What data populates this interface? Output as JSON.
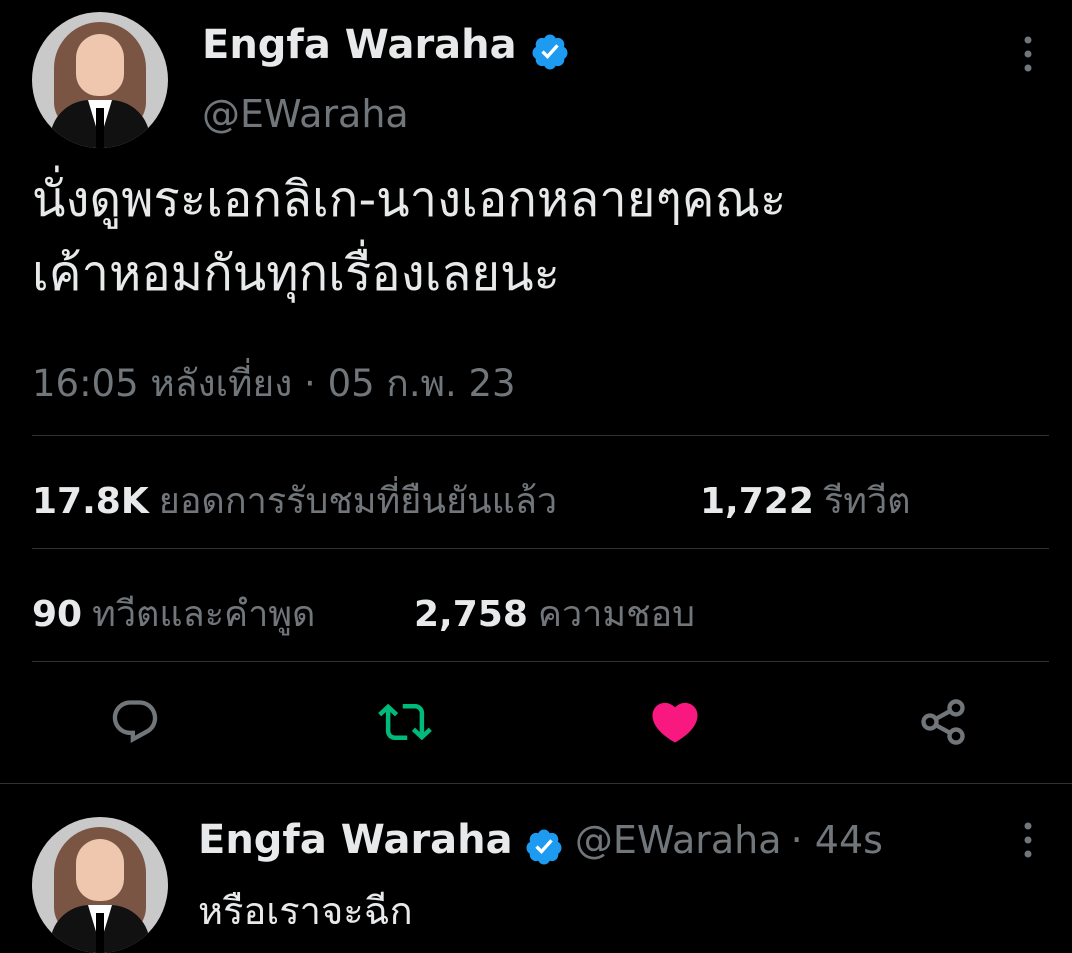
{
  "tweet": {
    "author_name": "Engfa Waraha",
    "author_handle": "@EWaraha",
    "text_line1": "นั่งดูพระเอกลิเก-นางเอกหลายๆคณะ",
    "text_line2": "เค้าหอมกันทุกเรื่องเลยนะ",
    "timestamp": "16:05 หลังเที่ยง · 05 ก.พ. 23"
  },
  "stats": {
    "views_count": "17.8K",
    "views_label": "ยอดการรับชมที่ยืนยันแล้ว",
    "retweets_count": "1,722",
    "retweets_label": "รีทวีต",
    "quotes_count": "90",
    "quotes_label": "ทวีตและคำพูด",
    "likes_count": "2,758",
    "likes_label": "ความชอบ"
  },
  "actions": {
    "reply_icon": "reply-icon",
    "retweet_icon": "retweet-icon",
    "like_icon": "heart-icon",
    "share_icon": "share-icon"
  },
  "reply": {
    "author_name": "Engfa Waraha",
    "author_handle": "@EWaraha",
    "time": "· 44s",
    "text": "หรือเราจะฉีก"
  },
  "colors": {
    "background": "#000000",
    "text": "#e7e9ea",
    "muted": "#71767b",
    "verified": "#1d9bf0",
    "retweet_active": "#00ba7c",
    "like_active": "#f91880"
  }
}
